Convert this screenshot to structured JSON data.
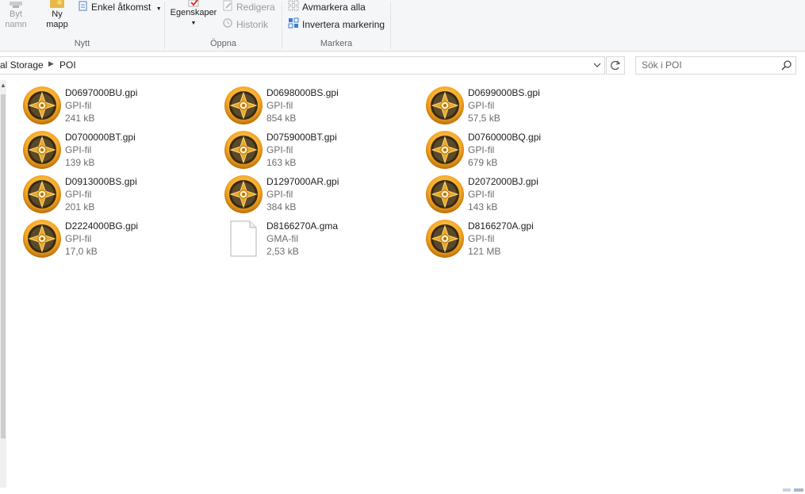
{
  "ribbon": {
    "rename": {
      "line1": "Byt",
      "line2": "namn"
    },
    "new_folder": {
      "line1": "Ny",
      "line2": "mapp"
    },
    "easy_access": "Enkel åtkomst",
    "group_new": "Nytt",
    "properties": "Egenskaper",
    "edit": "Redigera",
    "history": "Historik",
    "group_open": "Öppna",
    "deselect_all": "Avmarkera alla",
    "invert_selection": "Invertera markering",
    "group_select": "Markera"
  },
  "address": {
    "crumbs": [
      "al Storage",
      "POI"
    ]
  },
  "search": {
    "placeholder": "Sök i POI"
  },
  "files": [
    {
      "name": "D0697000BU.gpi",
      "type": "GPI-fil",
      "size": "241 kB",
      "icon": "gpi-poi-icon"
    },
    {
      "name": "D0698000BS.gpi",
      "type": "GPI-fil",
      "size": "854 kB",
      "icon": "gpi-poi-icon"
    },
    {
      "name": "D0699000BS.gpi",
      "type": "GPI-fil",
      "size": "57,5 kB",
      "icon": "gpi-poi-icon"
    },
    {
      "name": "D0700000BT.gpi",
      "type": "GPI-fil",
      "size": "139 kB",
      "icon": "gpi-poi-icon"
    },
    {
      "name": "D0759000BT.gpi",
      "type": "GPI-fil",
      "size": "163 kB",
      "icon": "gpi-poi-icon"
    },
    {
      "name": "D0760000BQ.gpi",
      "type": "GPI-fil",
      "size": "679 kB",
      "icon": "gpi-poi-icon"
    },
    {
      "name": "D0913000BS.gpi",
      "type": "GPI-fil",
      "size": "201 kB",
      "icon": "gpi-poi-icon"
    },
    {
      "name": "D1297000AR.gpi",
      "type": "GPI-fil",
      "size": "384 kB",
      "icon": "gpi-poi-icon"
    },
    {
      "name": "D2072000BJ.gpi",
      "type": "GPI-fil",
      "size": "143 kB",
      "icon": "gpi-poi-icon"
    },
    {
      "name": "D2224000BG.gpi",
      "type": "GPI-fil",
      "size": "17,0 kB",
      "icon": "gpi-poi-icon"
    },
    {
      "name": "D8166270A.gma",
      "type": "GMA-fil",
      "size": "2,53 kB",
      "icon": "blank-document-icon"
    },
    {
      "name": "D8166270A.gpi",
      "type": "GPI-fil",
      "size": "121 MB",
      "icon": "gpi-poi-icon"
    }
  ],
  "colors": {
    "accent": "#0078d7",
    "gpi_orange": "#f5a623",
    "gpi_dark": "#3a2a10"
  }
}
